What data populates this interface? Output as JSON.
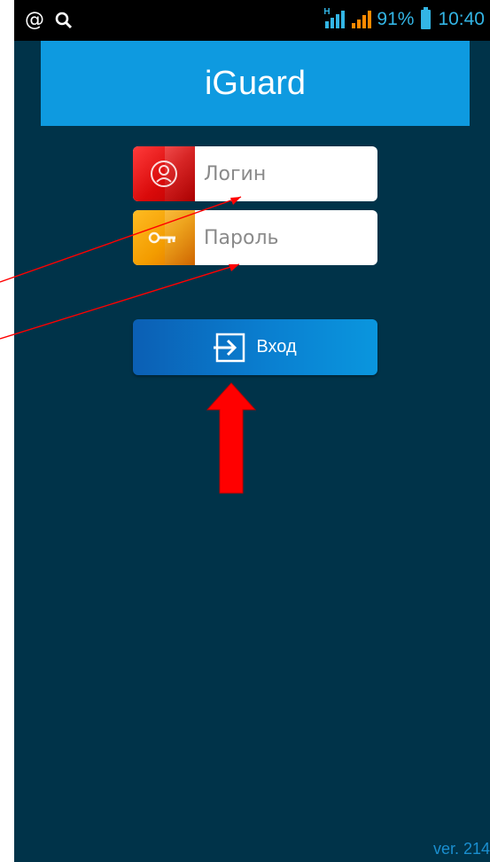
{
  "status_bar": {
    "left_icons": [
      "at-icon",
      "search-icon"
    ],
    "battery_percent": "91%",
    "time": "10:40",
    "network_type": "H"
  },
  "app": {
    "title": "iGuard"
  },
  "login_field": {
    "placeholder": "Логин",
    "value": ""
  },
  "password_field": {
    "placeholder": "Пароль",
    "value": ""
  },
  "login_button": {
    "label": "Вход"
  },
  "version_label": "ver. 214",
  "colors": {
    "background": "#003349",
    "header": "#0e9ae0",
    "accent": "#33b5e5",
    "annotation": "#ff0000"
  }
}
